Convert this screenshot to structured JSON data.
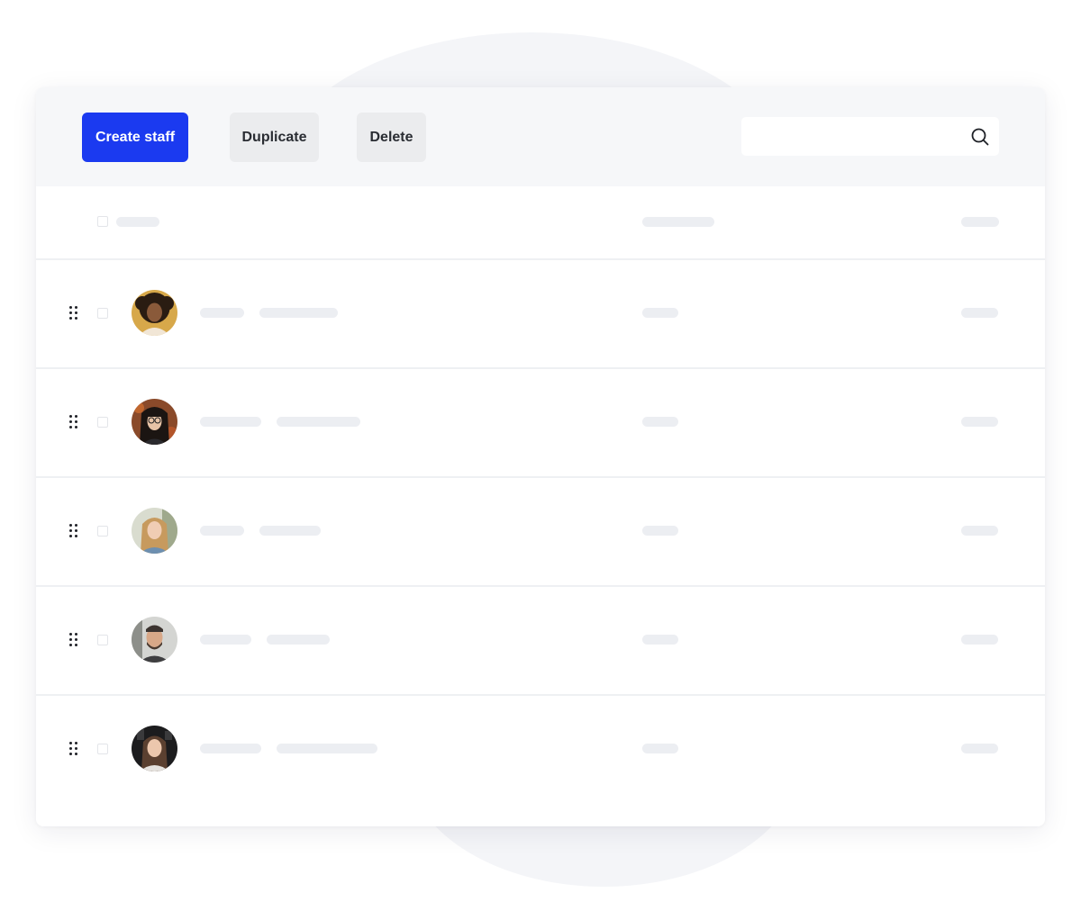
{
  "toolbar": {
    "create_label": "Create staff",
    "duplicate_label": "Duplicate",
    "delete_label": "Delete",
    "search": {
      "value": "",
      "placeholder": "",
      "icon": "search-icon"
    }
  },
  "colors": {
    "primary": "#1b3af0",
    "secondary_button": "#ebecee",
    "toolbar_bg": "#f6f7f9",
    "skeleton": "#eceef2"
  },
  "table": {
    "header_has_checkbox": true,
    "rows": [
      {
        "avatar": "staff-avatar-1",
        "drag_icon": "drag-handle-icon"
      },
      {
        "avatar": "staff-avatar-2",
        "drag_icon": "drag-handle-icon"
      },
      {
        "avatar": "staff-avatar-3",
        "drag_icon": "drag-handle-icon"
      },
      {
        "avatar": "staff-avatar-4",
        "drag_icon": "drag-handle-icon"
      },
      {
        "avatar": "staff-avatar-5",
        "drag_icon": "drag-handle-icon"
      }
    ]
  }
}
